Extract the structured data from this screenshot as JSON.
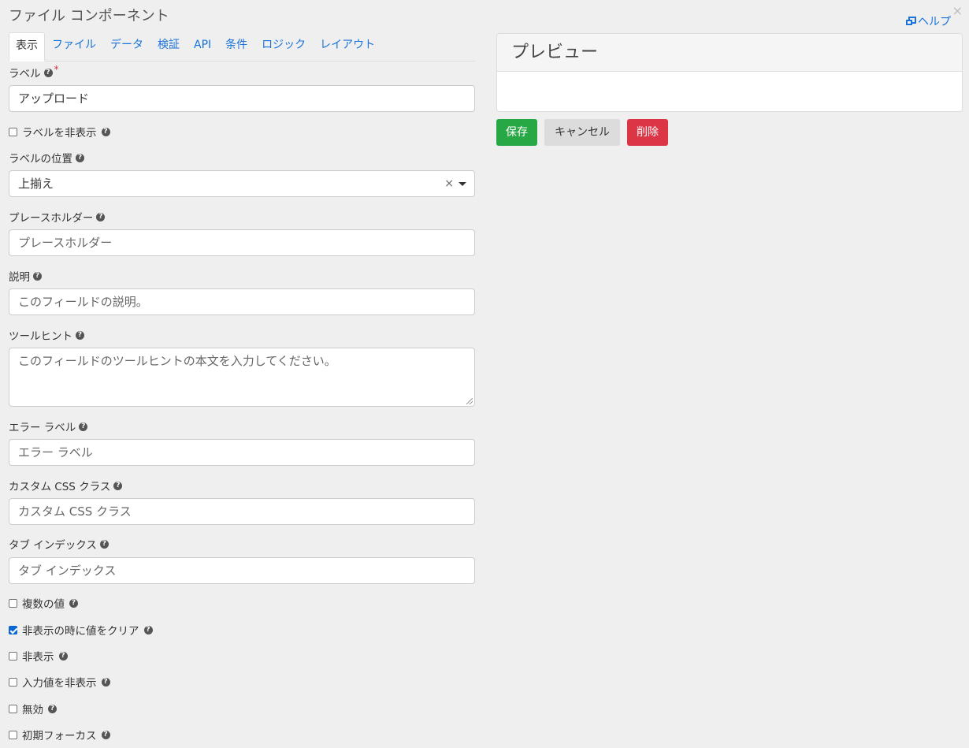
{
  "dialog": {
    "title": "ファイル コンポーネント",
    "help": "ヘルプ",
    "close": "×"
  },
  "tabs": [
    {
      "label": "表示",
      "active": true
    },
    {
      "label": "ファイル"
    },
    {
      "label": "データ"
    },
    {
      "label": "検証"
    },
    {
      "label": "API"
    },
    {
      "label": "条件"
    },
    {
      "label": "ロジック"
    },
    {
      "label": "レイアウト"
    }
  ],
  "form": {
    "label": {
      "label": "ラベル",
      "required": "*",
      "value": "アップロード"
    },
    "hideLabel": {
      "label": "ラベルを非表示",
      "checked": false
    },
    "labelPosition": {
      "label": "ラベルの位置",
      "value": "上揃え",
      "clear": "×"
    },
    "placeholder": {
      "label": "プレースホルダー",
      "placeholder": "プレースホルダー"
    },
    "description": {
      "label": "説明",
      "placeholder": "このフィールドの説明。"
    },
    "tooltip": {
      "label": "ツールヒント",
      "placeholder": "このフィールドのツールヒントの本文を入力してください。"
    },
    "errorLabel": {
      "label": "エラー ラベル",
      "placeholder": "エラー ラベル"
    },
    "customClass": {
      "label": "カスタム CSS クラス",
      "placeholder": "カスタム CSS クラス"
    },
    "tabindex": {
      "label": "タブ インデックス",
      "placeholder": "タブ インデックス"
    },
    "checkboxes": [
      {
        "label": "複数の値",
        "checked": false
      },
      {
        "label": "非表示の時に値をクリア",
        "checked": true
      },
      {
        "label": "非表示",
        "checked": false
      },
      {
        "label": "入力値を非表示",
        "checked": false
      },
      {
        "label": "無効",
        "checked": false
      },
      {
        "label": "初期フォーカス",
        "checked": false
      }
    ]
  },
  "preview": {
    "title": "プレビュー"
  },
  "buttons": {
    "save": "保存",
    "cancel": "キャンセル",
    "delete": "削除"
  },
  "colors": {
    "link": "#1a73d9",
    "save": "#28a745",
    "delete": "#dc3545",
    "cancel": "#dcdcdc"
  }
}
